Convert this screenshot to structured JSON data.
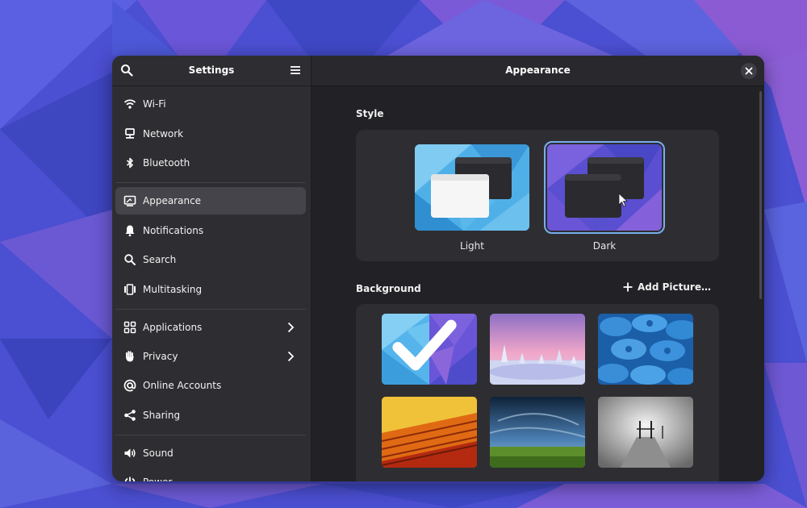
{
  "sidebar": {
    "title": "Settings",
    "header_icons": [
      "search-icon",
      "hamburger-menu-icon"
    ],
    "items": [
      {
        "label": "Wi-Fi",
        "icon": "wifi-icon"
      },
      {
        "label": "Network",
        "icon": "network-icon"
      },
      {
        "label": "Bluetooth",
        "icon": "bluetooth-icon"
      },
      {
        "label": "Appearance",
        "icon": "appearance-icon",
        "active": true
      },
      {
        "label": "Notifications",
        "icon": "bell-icon"
      },
      {
        "label": "Search",
        "icon": "search-icon"
      },
      {
        "label": "Multitasking",
        "icon": "multitasking-icon"
      },
      {
        "label": "Applications",
        "icon": "grid-icon",
        "has_submenu": true
      },
      {
        "label": "Privacy",
        "icon": "hand-icon",
        "has_submenu": true
      },
      {
        "label": "Online Accounts",
        "icon": "at-icon"
      },
      {
        "label": "Sharing",
        "icon": "share-icon"
      },
      {
        "label": "Sound",
        "icon": "speaker-icon"
      },
      {
        "label": "Power",
        "icon": "power-icon"
      }
    ]
  },
  "main": {
    "title": "Appearance",
    "style_label": "Style",
    "styles": [
      {
        "label": "Light",
        "selected": false
      },
      {
        "label": "Dark",
        "selected": true
      }
    ],
    "background_label": "Background",
    "add_picture_label": "Add Picture…",
    "backgrounds": [
      {
        "name": "default-triangles",
        "selected": true
      },
      {
        "name": "snowy-trees"
      },
      {
        "name": "blue-symbols"
      },
      {
        "name": "woven-fabric"
      },
      {
        "name": "green-field-sky"
      },
      {
        "name": "pier-fog"
      }
    ]
  },
  "colors": {
    "accent": "#78aeed",
    "window_bg": "#222226",
    "sidebar_bg": "#2e2e32",
    "wallpaper": "#4a4bd0"
  }
}
